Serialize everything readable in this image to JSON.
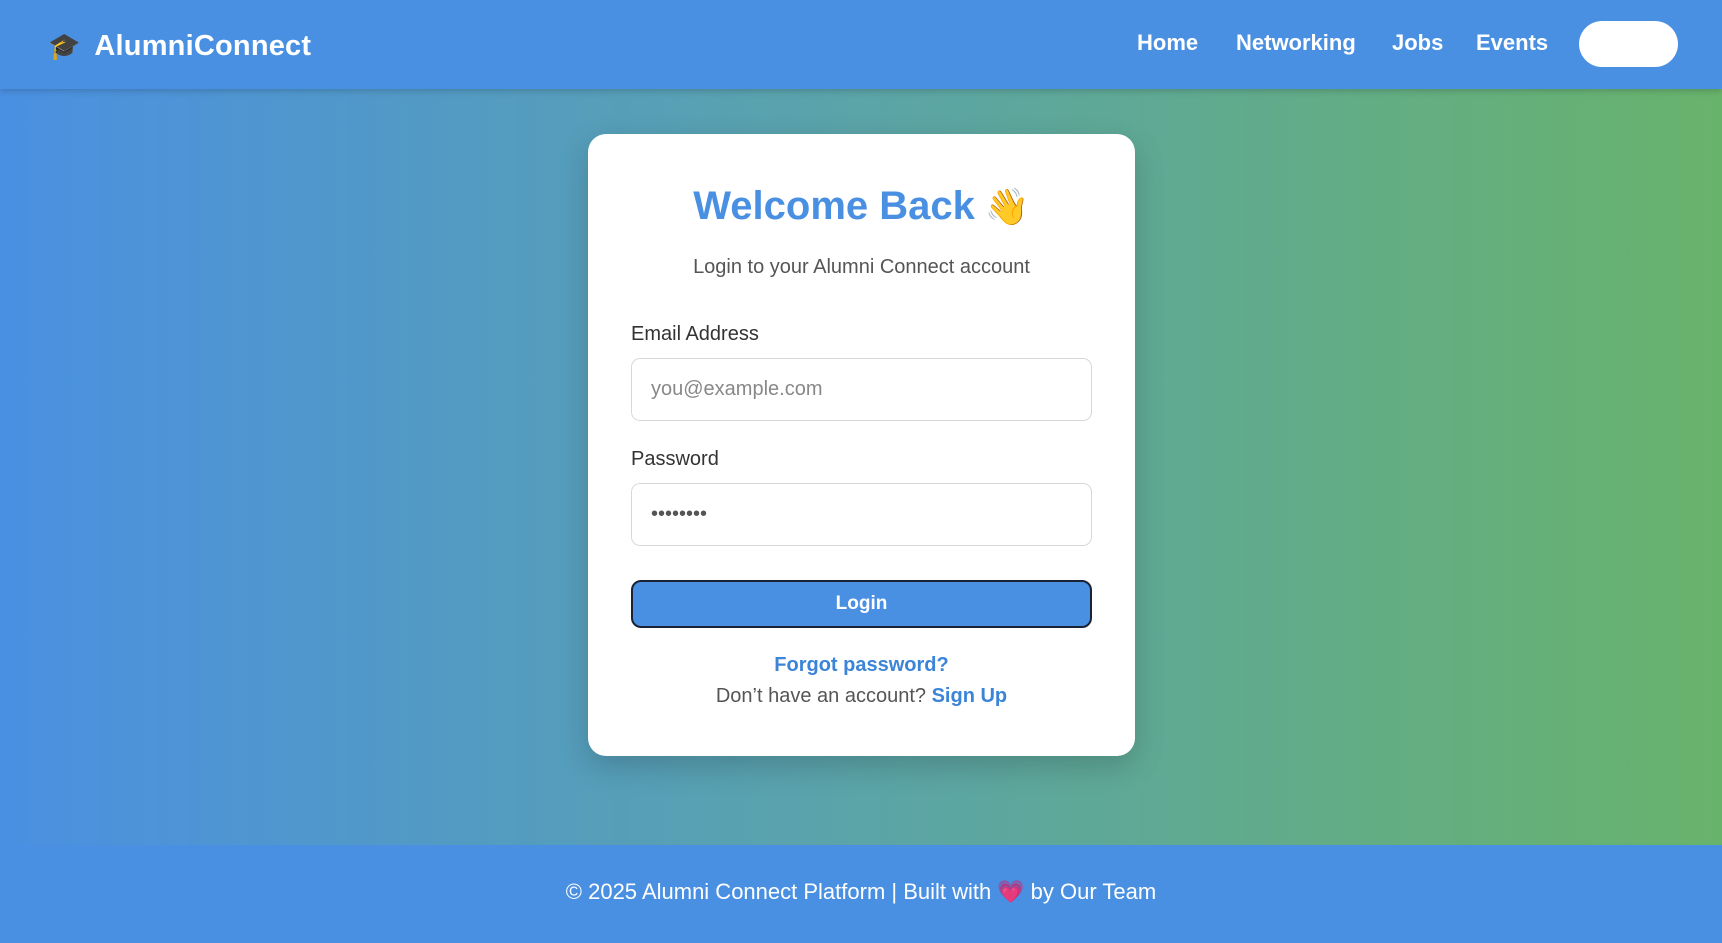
{
  "navbar": {
    "brand_icon": "🎓",
    "brand_name": "AlumniConnect",
    "links": [
      "Home",
      "Networking",
      "Jobs",
      "Events"
    ]
  },
  "login_card": {
    "title": "Welcome Back",
    "title_emoji": "👋",
    "subtitle": "Login to your Alumni Connect account",
    "email_label": "Email Address",
    "email_placeholder": "you@example.com",
    "password_label": "Password",
    "password_value": "••••••••",
    "login_button": "Login",
    "forgot_link": "Forgot password?",
    "signup_prompt": "Don’t have an account?",
    "signup_link": "Sign Up"
  },
  "footer": {
    "text_before": "© 2025 Alumni Connect Platform | Built with",
    "heart": "💗",
    "text_after": "by Our Team"
  },
  "colors": {
    "brand_blue": "#4a90e2",
    "gradient_end_green": "#68b36c",
    "link_blue": "#3b84d8"
  }
}
